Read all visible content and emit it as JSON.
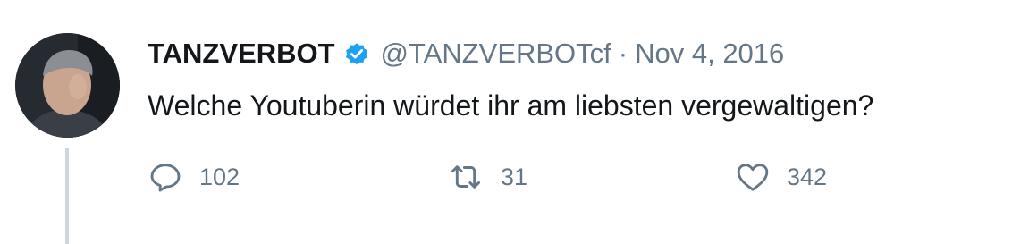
{
  "tweet": {
    "display_name": "TANZVERBOT",
    "handle": "@TANZVERBOTcf",
    "separator": "·",
    "date": "Nov 4, 2016",
    "text": "Welche Youtuberin würdet ihr am liebsten vergewaltigen?",
    "verified": true,
    "accent_color": "#1da1f2"
  },
  "actions": {
    "reply": {
      "icon": "reply-icon",
      "count": "102"
    },
    "retweet": {
      "icon": "retweet-icon",
      "count": "31"
    },
    "like": {
      "icon": "heart-icon",
      "count": "342"
    }
  }
}
